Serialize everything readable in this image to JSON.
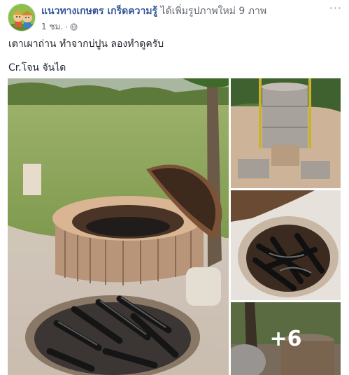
{
  "header": {
    "page_name": "แนวทางเกษตร เกร็ดความรู้",
    "action": " ได้เพิ่มรูปภาพใหม่ 9 ภาพ",
    "time": "1 ชม.",
    "dot": "·",
    "more": "···"
  },
  "post": {
    "line1": "เตาเผาถ่าน ทำจากบ่ปูน ลองทำดูครับ",
    "line2": "Cr.โจน จันได"
  },
  "gallery": {
    "more_count": "+6"
  },
  "colors": {
    "link": "#365899",
    "meta": "#616770"
  }
}
